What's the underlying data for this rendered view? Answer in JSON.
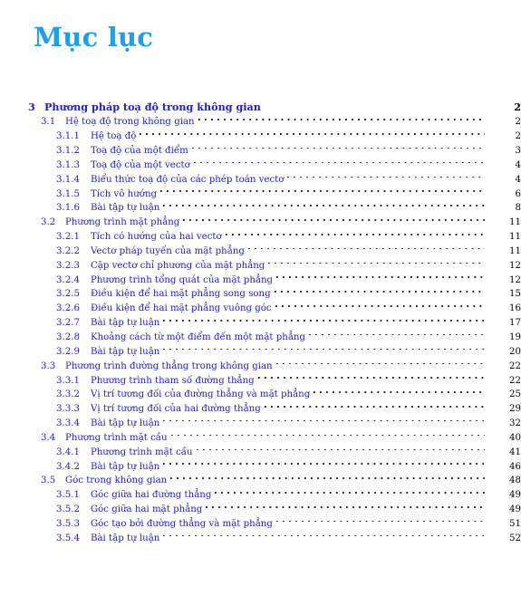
{
  "title": "Mục lục",
  "colors": {
    "title": "#1e9fe8",
    "entry": "#2020cc",
    "page_number": "#000000",
    "leader_dot": "#16161a"
  },
  "entries": [
    {
      "level": "chapter",
      "number": "3",
      "label": "Phương pháp toạ độ trong không gian",
      "page": "2",
      "leader": false
    },
    {
      "level": "section",
      "number": "3.1",
      "label": "Hệ toạ độ trong không gian",
      "page": "2",
      "leader": true
    },
    {
      "level": "sub",
      "number": "3.1.1",
      "label": "Hệ toạ độ",
      "page": "2",
      "leader": true
    },
    {
      "level": "sub",
      "number": "3.1.2",
      "label": "Toạ độ của một điểm",
      "page": "3",
      "leader": true
    },
    {
      "level": "sub",
      "number": "3.1.3",
      "label": "Toạ độ của một vectơ",
      "page": "4",
      "leader": true
    },
    {
      "level": "sub",
      "number": "3.1.4",
      "label": "Biểu thức toạ độ của các phép toán vectơ",
      "page": "4",
      "leader": true
    },
    {
      "level": "sub",
      "number": "3.1.5",
      "label": "Tích vô hướng",
      "page": "6",
      "leader": true
    },
    {
      "level": "sub",
      "number": "3.1.6",
      "label": "Bài tập tự luận",
      "page": "8",
      "leader": true
    },
    {
      "level": "section",
      "number": "3.2",
      "label": "Phương trình mặt phẳng",
      "page": "11",
      "leader": true
    },
    {
      "level": "sub",
      "number": "3.2.1",
      "label": "Tích có hướng của hai vectơ",
      "page": "11",
      "leader": true
    },
    {
      "level": "sub",
      "number": "3.2.2",
      "label": "Vectơ pháp tuyến của mặt phẳng",
      "page": "11",
      "leader": true
    },
    {
      "level": "sub",
      "number": "3.2.3",
      "label": "Cặp vectơ chỉ phương của mặt phẳng",
      "page": "12",
      "leader": true
    },
    {
      "level": "sub",
      "number": "3.2.4",
      "label": "Phương trình tổng quát của mặt phẳng",
      "page": "12",
      "leader": true
    },
    {
      "level": "sub",
      "number": "3.2.5",
      "label": "Điều kiện để hai mặt phẳng song song",
      "page": "15",
      "leader": true
    },
    {
      "level": "sub",
      "number": "3.2.6",
      "label": "Điều kiện để hai mặt phẳng vuông góc",
      "page": "16",
      "leader": true
    },
    {
      "level": "sub",
      "number": "3.2.7",
      "label": "Bài tập tự luận",
      "page": "17",
      "leader": true
    },
    {
      "level": "sub",
      "number": "3.2.8",
      "label": "Khoảng cách từ một điểm đến một mặt phẳng",
      "page": "19",
      "leader": true
    },
    {
      "level": "sub",
      "number": "3.2.9",
      "label": "Bài tập tự luận",
      "page": "20",
      "leader": true
    },
    {
      "level": "section",
      "number": "3.3",
      "label": "Phương trình đường thẳng trong không gian",
      "page": "22",
      "leader": true
    },
    {
      "level": "sub",
      "number": "3.3.1",
      "label": "Phương trình tham số đường thẳng",
      "page": "22",
      "leader": true
    },
    {
      "level": "sub",
      "number": "3.3.2",
      "label": "Vị trí tương đối của đường thẳng và mặt phẳng",
      "page": "25",
      "leader": true
    },
    {
      "level": "sub",
      "number": "3.3.3",
      "label": "Vị trí tương đối của hai đường thẳng",
      "page": "29",
      "leader": true
    },
    {
      "level": "sub",
      "number": "3.3.4",
      "label": "Bài tập tự luận",
      "page": "32",
      "leader": true
    },
    {
      "level": "section",
      "number": "3.4",
      "label": "Phương trình mặt cầu",
      "page": "40",
      "leader": true
    },
    {
      "level": "sub",
      "number": "3.4.1",
      "label": "Phương trình mặt cầu",
      "page": "41",
      "leader": true
    },
    {
      "level": "sub",
      "number": "3.4.2",
      "label": "Bài tập tự luận",
      "page": "46",
      "leader": true
    },
    {
      "level": "section",
      "number": "3.5",
      "label": "Góc trong không gian",
      "page": "48",
      "leader": true
    },
    {
      "level": "sub",
      "number": "3.5.1",
      "label": "Góc giữa hai đường thẳng",
      "page": "49",
      "leader": true
    },
    {
      "level": "sub",
      "number": "3.5.2",
      "label": "Góc giữa hai mặt phẳng",
      "page": "49",
      "leader": true
    },
    {
      "level": "sub",
      "number": "3.5.3",
      "label": "Góc tạo bởi đường thẳng và mặt phẳng",
      "page": "51",
      "leader": true
    },
    {
      "level": "sub",
      "number": "3.5.4",
      "label": "Bài tập tự luận",
      "page": "52",
      "leader": true
    }
  ]
}
